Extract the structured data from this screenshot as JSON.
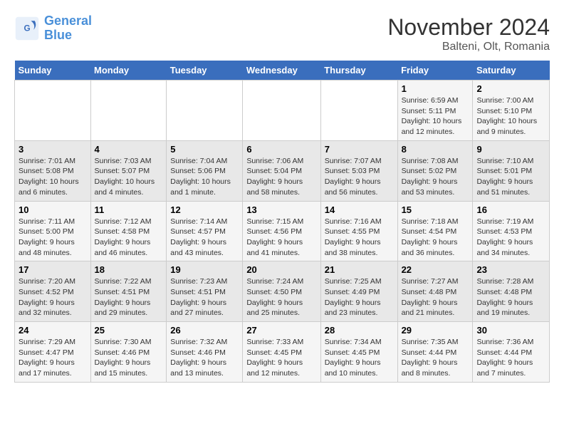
{
  "logo": {
    "line1": "General",
    "line2": "Blue"
  },
  "title": "November 2024",
  "subtitle": "Balteni, Olt, Romania",
  "weekdays": [
    "Sunday",
    "Monday",
    "Tuesday",
    "Wednesday",
    "Thursday",
    "Friday",
    "Saturday"
  ],
  "weeks": [
    [
      {
        "day": "",
        "info": ""
      },
      {
        "day": "",
        "info": ""
      },
      {
        "day": "",
        "info": ""
      },
      {
        "day": "",
        "info": ""
      },
      {
        "day": "",
        "info": ""
      },
      {
        "day": "1",
        "info": "Sunrise: 6:59 AM\nSunset: 5:11 PM\nDaylight: 10 hours and 12 minutes."
      },
      {
        "day": "2",
        "info": "Sunrise: 7:00 AM\nSunset: 5:10 PM\nDaylight: 10 hours and 9 minutes."
      }
    ],
    [
      {
        "day": "3",
        "info": "Sunrise: 7:01 AM\nSunset: 5:08 PM\nDaylight: 10 hours and 6 minutes."
      },
      {
        "day": "4",
        "info": "Sunrise: 7:03 AM\nSunset: 5:07 PM\nDaylight: 10 hours and 4 minutes."
      },
      {
        "day": "5",
        "info": "Sunrise: 7:04 AM\nSunset: 5:06 PM\nDaylight: 10 hours and 1 minute."
      },
      {
        "day": "6",
        "info": "Sunrise: 7:06 AM\nSunset: 5:04 PM\nDaylight: 9 hours and 58 minutes."
      },
      {
        "day": "7",
        "info": "Sunrise: 7:07 AM\nSunset: 5:03 PM\nDaylight: 9 hours and 56 minutes."
      },
      {
        "day": "8",
        "info": "Sunrise: 7:08 AM\nSunset: 5:02 PM\nDaylight: 9 hours and 53 minutes."
      },
      {
        "day": "9",
        "info": "Sunrise: 7:10 AM\nSunset: 5:01 PM\nDaylight: 9 hours and 51 minutes."
      }
    ],
    [
      {
        "day": "10",
        "info": "Sunrise: 7:11 AM\nSunset: 5:00 PM\nDaylight: 9 hours and 48 minutes."
      },
      {
        "day": "11",
        "info": "Sunrise: 7:12 AM\nSunset: 4:58 PM\nDaylight: 9 hours and 46 minutes."
      },
      {
        "day": "12",
        "info": "Sunrise: 7:14 AM\nSunset: 4:57 PM\nDaylight: 9 hours and 43 minutes."
      },
      {
        "day": "13",
        "info": "Sunrise: 7:15 AM\nSunset: 4:56 PM\nDaylight: 9 hours and 41 minutes."
      },
      {
        "day": "14",
        "info": "Sunrise: 7:16 AM\nSunset: 4:55 PM\nDaylight: 9 hours and 38 minutes."
      },
      {
        "day": "15",
        "info": "Sunrise: 7:18 AM\nSunset: 4:54 PM\nDaylight: 9 hours and 36 minutes."
      },
      {
        "day": "16",
        "info": "Sunrise: 7:19 AM\nSunset: 4:53 PM\nDaylight: 9 hours and 34 minutes."
      }
    ],
    [
      {
        "day": "17",
        "info": "Sunrise: 7:20 AM\nSunset: 4:52 PM\nDaylight: 9 hours and 32 minutes."
      },
      {
        "day": "18",
        "info": "Sunrise: 7:22 AM\nSunset: 4:51 PM\nDaylight: 9 hours and 29 minutes."
      },
      {
        "day": "19",
        "info": "Sunrise: 7:23 AM\nSunset: 4:51 PM\nDaylight: 9 hours and 27 minutes."
      },
      {
        "day": "20",
        "info": "Sunrise: 7:24 AM\nSunset: 4:50 PM\nDaylight: 9 hours and 25 minutes."
      },
      {
        "day": "21",
        "info": "Sunrise: 7:25 AM\nSunset: 4:49 PM\nDaylight: 9 hours and 23 minutes."
      },
      {
        "day": "22",
        "info": "Sunrise: 7:27 AM\nSunset: 4:48 PM\nDaylight: 9 hours and 21 minutes."
      },
      {
        "day": "23",
        "info": "Sunrise: 7:28 AM\nSunset: 4:48 PM\nDaylight: 9 hours and 19 minutes."
      }
    ],
    [
      {
        "day": "24",
        "info": "Sunrise: 7:29 AM\nSunset: 4:47 PM\nDaylight: 9 hours and 17 minutes."
      },
      {
        "day": "25",
        "info": "Sunrise: 7:30 AM\nSunset: 4:46 PM\nDaylight: 9 hours and 15 minutes."
      },
      {
        "day": "26",
        "info": "Sunrise: 7:32 AM\nSunset: 4:46 PM\nDaylight: 9 hours and 13 minutes."
      },
      {
        "day": "27",
        "info": "Sunrise: 7:33 AM\nSunset: 4:45 PM\nDaylight: 9 hours and 12 minutes."
      },
      {
        "day": "28",
        "info": "Sunrise: 7:34 AM\nSunset: 4:45 PM\nDaylight: 9 hours and 10 minutes."
      },
      {
        "day": "29",
        "info": "Sunrise: 7:35 AM\nSunset: 4:44 PM\nDaylight: 9 hours and 8 minutes."
      },
      {
        "day": "30",
        "info": "Sunrise: 7:36 AM\nSunset: 4:44 PM\nDaylight: 9 hours and 7 minutes."
      }
    ]
  ]
}
